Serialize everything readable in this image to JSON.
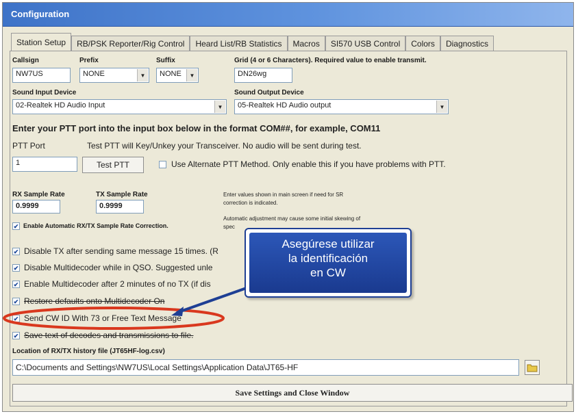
{
  "window": {
    "title": "Configuration"
  },
  "tabs": [
    "Station Setup",
    "RB/PSK Reporter/Rig Control",
    "Heard List/RB Statistics",
    "Macros",
    "SI570 USB Control",
    "Colors",
    "Diagnostics"
  ],
  "station": {
    "callsign_label": "Callsign",
    "callsign_value": "NW7US",
    "prefix_label": "Prefix",
    "prefix_value": "NONE",
    "suffix_label": "Suffix",
    "suffix_value": "NONE",
    "grid_label": "Grid (4 or 6 Characters). Required value to enable transmit.",
    "grid_value": "DN26wg"
  },
  "sound": {
    "input_label": "Sound Input Device",
    "input_value": "02-Realtek HD Audio Input",
    "output_label": "Sound Output Device",
    "output_value": "05-Realtek HD Audio output"
  },
  "ptt": {
    "heading": "Enter your PTT port into the input box below in the format COM##, for example, COM11",
    "port_label": "PTT Port",
    "test_note": "Test PTT will Key/Unkey your Transceiver.  No audio will be sent during test.",
    "port_value": "1",
    "test_button": "Test PTT",
    "alt_label": "Use Alternate PTT Method.  Only enable this if you have problems with PTT."
  },
  "sample": {
    "rx_label": "RX Sample Rate",
    "rx_value": "0.9999",
    "tx_label": "TX Sample Rate",
    "tx_value": "0.9999",
    "note1_a": "Enter values shown in main screen if need for SR",
    "note1_b": "correction is indicated.",
    "note2_a": "Automatic adjustment may cause some initial skewing of",
    "note2_b": "spec",
    "auto_label": "Enable Automatic RX/TX Sample Rate Correction."
  },
  "options": [
    {
      "label": "Disable TX after sending same message 15 times.  (R",
      "checked": true
    },
    {
      "label": "Disable Multidecoder while in QSO.  Suggested unle",
      "checked": true
    },
    {
      "label": "Enable Multidecoder after 2 minutes of no TX (if dis",
      "checked": true
    },
    {
      "label": "Restore defaults onto Multidecoder On",
      "checked": true
    },
    {
      "label": "Send CW ID With 73 or Free Text Message",
      "checked": true
    },
    {
      "label": "Save text of decodes and transmissions to file.",
      "checked": true
    }
  ],
  "history": {
    "label": "Location of RX/TX history file (JT65HF-log.csv)",
    "value": "C:\\Documents and Settings\\NW7US\\Local Settings\\Application Data\\JT65-HF"
  },
  "save_button": "Save Settings and Close Window",
  "callout": {
    "line1": "Asegúrese utilizar",
    "line2": "la identificación",
    "line3": "en CW"
  },
  "colors": {
    "title_bar": "#3e73c8",
    "callout_fill": "#1a3a8f",
    "highlight_ellipse": "#d9381e",
    "arrow": "#1e3f94"
  }
}
